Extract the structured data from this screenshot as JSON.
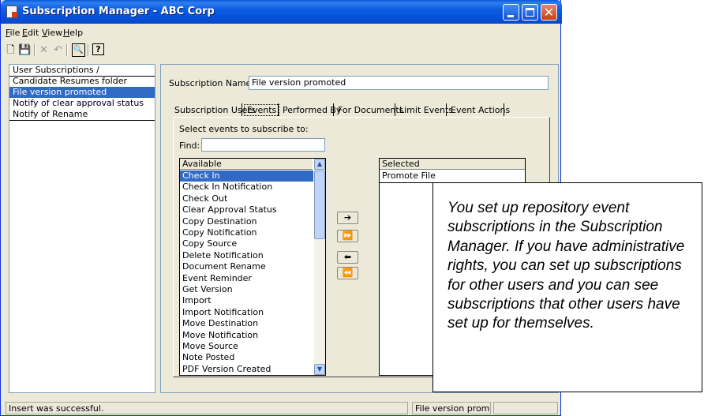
{
  "window": {
    "title": "Subscription Manager - ABC Corp"
  },
  "menu": [
    {
      "label": "File",
      "key": "F",
      "rest": "ile"
    },
    {
      "label": "Edit",
      "key": "E",
      "rest": "dit"
    },
    {
      "label": "View",
      "key": "V",
      "rest": "iew"
    },
    {
      "label": "Help",
      "key": "H",
      "rest": "elp"
    }
  ],
  "toolbar": {
    "icons": [
      "new-document-icon",
      "save-icon",
      "delete-icon",
      "undo-icon",
      "find-icon",
      "help-icon"
    ],
    "new_glyph": "🗋",
    "save_glyph": "💾",
    "delete_glyph": "✕",
    "undo_glyph": "↶",
    "find_glyph": "🔍",
    "help_glyph": "?"
  },
  "left_pane": {
    "items": [
      {
        "label": "User Subscriptions /"
      },
      {
        "label": "Candidate Resumes folder"
      },
      {
        "label": "File version promoted",
        "selected": true
      },
      {
        "label": "Notify of clear approval status"
      },
      {
        "label": "Notify of Rename"
      }
    ]
  },
  "detail": {
    "name_label": "Subscription Name",
    "name_value": "File version promoted",
    "tabs": [
      {
        "label": "Subscription Users"
      },
      {
        "label": "Events",
        "active": true
      },
      {
        "label": "Performed By"
      },
      {
        "label": "For Documents"
      },
      {
        "label": "Limit Events"
      },
      {
        "label": "Event Actions"
      }
    ],
    "instructions": "Select events to subscribe to:",
    "find_label": "Find:",
    "find_value": "",
    "available": {
      "header": "Available",
      "items": [
        "Check In",
        "Check In Notification",
        "Check Out",
        "Clear Approval Status",
        "Copy Destination",
        "Copy Notification",
        "Copy Source",
        "Delete Notification",
        "Document Rename",
        "Event Reminder",
        "Get Version",
        "Import",
        "Import Notification",
        "Move Destination",
        "Move Notification",
        "Move Source",
        "Note Posted",
        "PDF Version Created"
      ],
      "selected_index": 0
    },
    "move_buttons": {
      "add": "➔",
      "add_all": "⏩",
      "remove": "⬅",
      "remove_all": "⏪"
    },
    "selected": {
      "header": "Selected",
      "items": [
        "Promote File"
      ]
    }
  },
  "status": {
    "message": "Insert was successful.",
    "current": "File version promoted",
    "extra": ""
  },
  "callout": {
    "text": "You set up repository event subscriptions in the Subscription Manager.  If you have administrative rights, you can set up subscriptions for other users and you can see subscriptions that other users have set up for themselves."
  },
  "colors": {
    "title_bar": "#0a5ad8",
    "selection": "#316ac5",
    "window_bg": "#ece9d8"
  }
}
